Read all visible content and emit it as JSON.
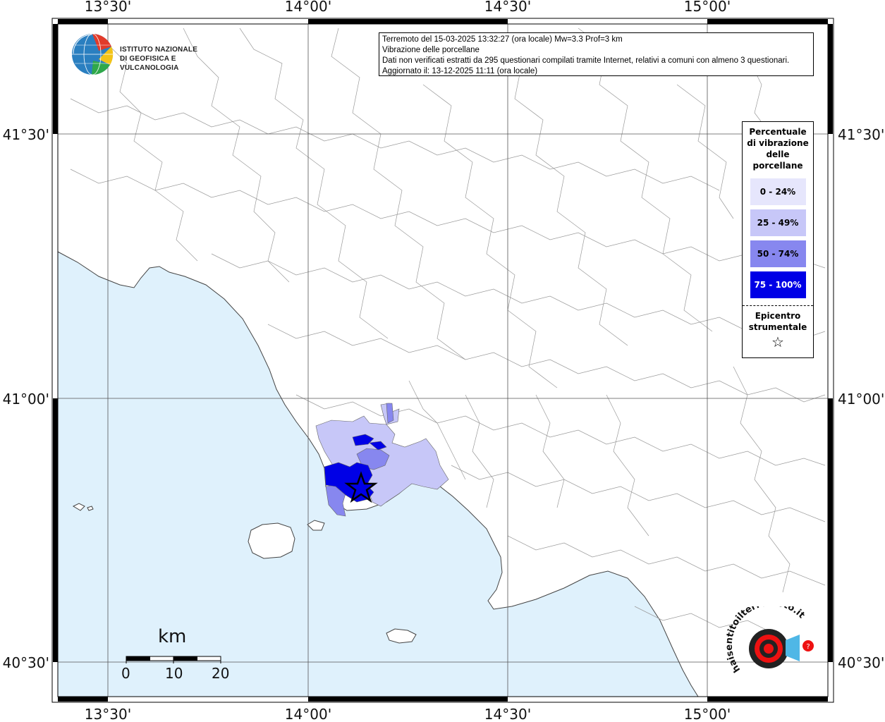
{
  "map": {
    "title_lines": [
      "Terremoto del 15-03-2025 13:32:27 (ora locale) Mw=3.3 Prof=3 km",
      "Vibrazione delle porcellane",
      "Dati non verificati estratti da 295 questionari compilati tramite Internet, relativi a comuni con almeno 3 questionari.",
      "Aggiornato il: 13-12-2025 11:11 (ora locale)"
    ],
    "longitude_labels": [
      "13°30'",
      "14°00'",
      "14°30'",
      "15°00'"
    ],
    "latitude_labels": [
      "41°30'",
      "41°00'",
      "40°30'"
    ],
    "institution": {
      "line1": "ISTITUTO NAZIONALE",
      "line2": "DI GEOFISICA E VULCANOLOGIA"
    },
    "legend": {
      "title": "Percentuale di vibrazione delle porcellane",
      "classes": [
        {
          "label": "0 - 24%",
          "color": "#e6e6fc"
        },
        {
          "label": "25 - 49%",
          "color": "#c7c7f8"
        },
        {
          "label": "50 - 74%",
          "color": "#8787ef"
        },
        {
          "label": "75 - 100%",
          "color": "#0000e6"
        }
      ],
      "epicenter_label": "Epicentro strumentale",
      "epicenter_symbol": "☆"
    },
    "scale_bar": {
      "unit": "km",
      "ticks": [
        "0",
        "10",
        "20"
      ]
    },
    "colors": {
      "sea": "#dff1fc",
      "land": "#ffffff",
      "border": "#000000"
    },
    "epicenter_icon": "star-icon",
    "website_logo": "haisentitoilterremoto.it"
  }
}
